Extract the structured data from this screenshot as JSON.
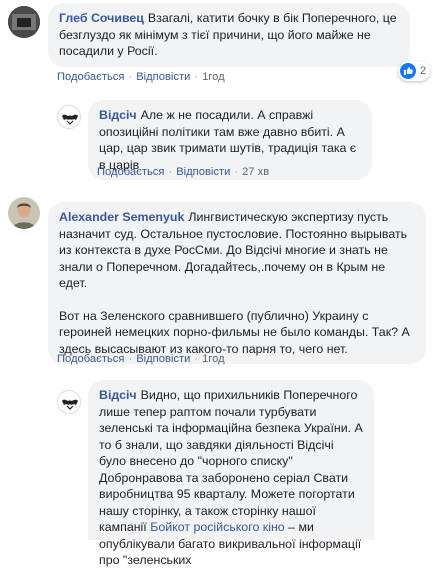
{
  "comments": [
    {
      "author": "Глеб Сочивец",
      "text": "Взагалі, катити бочку в бік Поперечного, це безглуздо як мінімум з тієї причини, що його майже не посадили у Росії.",
      "actions": {
        "like": "Подобається",
        "reply": "Відповісти",
        "time": "1год"
      },
      "reactions": {
        "icon": "like-icon",
        "count": "2"
      }
    },
    {
      "author": "Відсіч",
      "text": "Але ж не посадили. А справжі опозиційні політики там вже давно вбиті. А цар, цар звик тримати шутів, традиція така є в царів",
      "actions": {
        "like": "Подобається",
        "reply": "Відповісти",
        "time": "27 хв"
      }
    },
    {
      "author": "Alexander Semenyuk",
      "text": "Лингвистическую экспертизу пусть назначит суд. Остальное пустословие. Постоянно вырывать из контекста в духе РосСми. До Відсічі многие и знать не знали о Поперечном. Догадайтесь,.почему он в Крым не едет.",
      "text2": "Вот на Зеленского сравнившего (публично) Украину с героиней немецких порно-фильмы не было команды. Так? А здесь высасывают из какого-то парня то, чего нет.",
      "actions": {
        "like": "Подобається",
        "reply": "Відповісти",
        "time": "1год"
      }
    },
    {
      "author": "Відсіч",
      "text": "Видно, що прихильників Поперечного лише тепер раптом почали турбувати зеленські та інформаційна безпека України. А то б знали, що завдяки діяльності Відсічі було внесено до \"чорного списку\" Добронравова та заборонено серіал Свати виробництва 95 кварталу. Можете погортати нашу сторінку, а також сторінку нашої кампанії",
      "link": "Бойкот російського кіно",
      "text_after_link": " – ми опублікували багато викривальної інформації про \"зеленських"
    }
  ],
  "colors": {
    "link": "#385898",
    "bubble": "#f2f3f5",
    "like_blue": "#1877f2",
    "meta": "#616770"
  }
}
